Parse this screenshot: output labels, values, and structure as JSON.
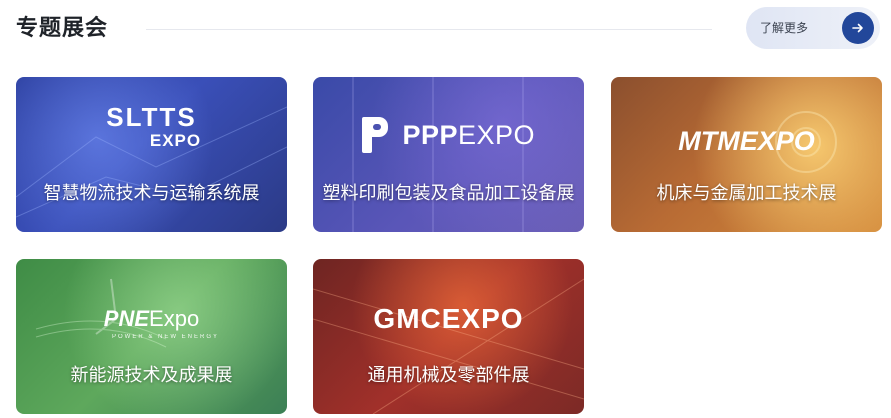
{
  "header": {
    "title": "专题展会",
    "more_label": "了解更多",
    "more_icon": "arrow-right-icon"
  },
  "cards": [
    {
      "label": "智慧物流技术与运输系统展",
      "logo_line1": "SLTTS",
      "logo_line2": "EXPO",
      "color": "#3449a8"
    },
    {
      "label": "塑料印刷包装及食品加工设备展",
      "logo_bold": "PPP",
      "logo_light": "EXPO",
      "color": "#5a56b8"
    },
    {
      "label": "机床与金属加工技术展",
      "logo": "MTMEXPO",
      "color": "#c07a38"
    },
    {
      "label": "新能源技术及成果展",
      "logo_bold": "PNE",
      "logo_light": "Expo",
      "logo_sub": "POWER & NEW ENERGY",
      "color": "#4f9a52"
    },
    {
      "label": "通用机械及零部件展",
      "logo": "GMCEXPO",
      "color": "#93302a"
    }
  ],
  "colors": {
    "title": "#1f2329",
    "accent": "#22479a",
    "more_button_bg": "#e4e9f6"
  }
}
